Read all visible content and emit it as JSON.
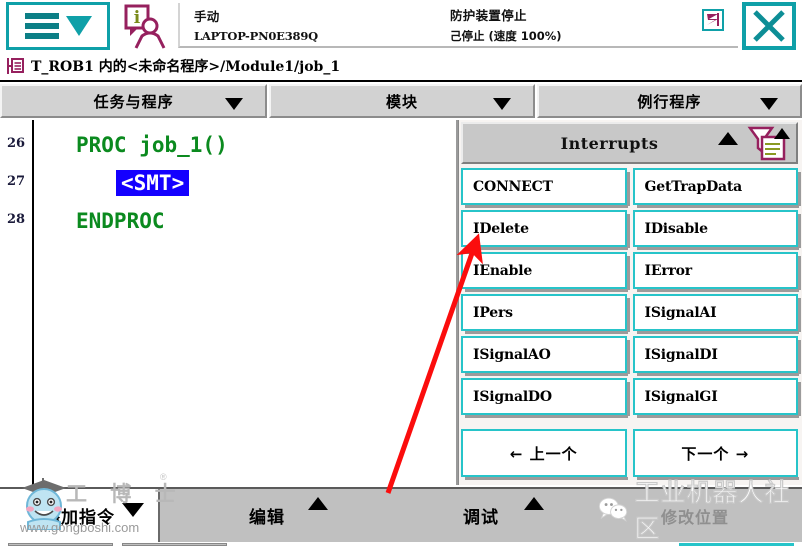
{
  "header": {
    "menu_icon": "hamburger-chevron-icon",
    "info_icon": "operator-info-icon",
    "mode": "手动",
    "controller_name": "LAPTOP-PN0E389Q",
    "safety_state": "防护装置停止",
    "run_state": "己停止 (速度 100%)",
    "status_icon": "task-status-icon",
    "close_icon": "close-x-icon"
  },
  "breadcrumb": {
    "icon": "program-module-icon",
    "path": "T_ROB1 内的<未命名程序>/Module1/job_1"
  },
  "tabs": [
    {
      "label": "任务与程序",
      "arrow": "chevron-down-icon"
    },
    {
      "label": "模块",
      "arrow": "chevron-down-icon"
    },
    {
      "label": "例行程序",
      "arrow": "chevron-down-icon"
    }
  ],
  "editor": {
    "line_numbers": [
      "26",
      "27",
      "28"
    ],
    "lines": [
      {
        "text": "PROC job_1()",
        "selected": false
      },
      {
        "text": "<SMT>",
        "selected": true
      },
      {
        "text": "ENDPROC",
        "selected": false
      }
    ]
  },
  "panel": {
    "title": "Interrupts",
    "collapse_icon": "triangle-up-icon",
    "filter_icon": "filter-list-icon",
    "buttons": [
      "CONNECT",
      "GetTrapData",
      "IDelete",
      "IDisable",
      "IEnable",
      "IError",
      "IPers",
      "ISignalAI",
      "ISignalAO",
      "ISignalDI",
      "ISignalDO",
      "ISignalGI"
    ],
    "prev_label": "←  上一个",
    "next_label": "下一个  →"
  },
  "bottom_bar": {
    "add_instruction": "添加指令",
    "edit": "编辑",
    "debug": "调试",
    "modify_position": "修改位置"
  },
  "watermarks": {
    "left_text": "工 博 士",
    "left_url": "www.gongboshi.com",
    "right_text": "工业机器人社区",
    "right_icon": "wechat-icon"
  },
  "annotation": {
    "arrow_color": "#fb0d0d",
    "target": "IDelete"
  },
  "colors": {
    "accent": "#0fa0a8",
    "button_border": "#27c4c9",
    "code_green": "#0b8a1f",
    "selection_blue": "#1400ff",
    "panel_gray": "#c8c8c8",
    "bar_gray": "#c0c0c0",
    "icon_magenta": "#96205e"
  }
}
